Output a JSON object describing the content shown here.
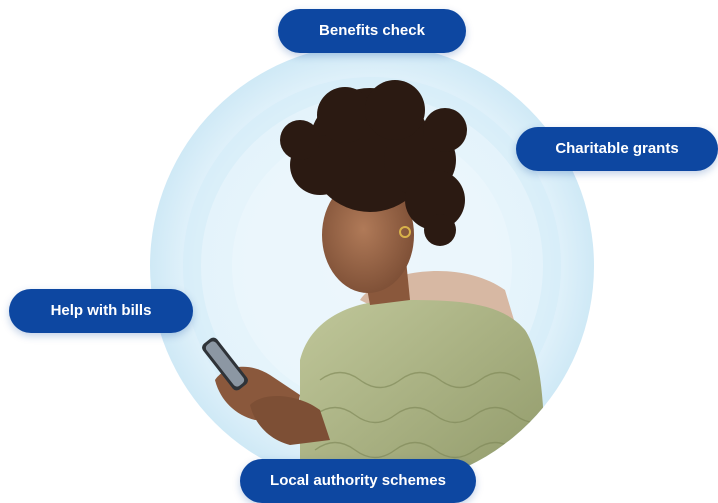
{
  "pills": {
    "benefits_check": "Benefits check",
    "charitable_grants": "Charitable grants",
    "help_with_bills": "Help with bills",
    "local_authority_schemes": "Local authority schemes"
  },
  "photo": {
    "subject": "woman looking at smartphone"
  },
  "colors": {
    "pill_background": "#0d47a1",
    "pill_text": "#ffffff",
    "ring_light": "#e8f4fb",
    "ring_mid": "#d3ecf8"
  }
}
